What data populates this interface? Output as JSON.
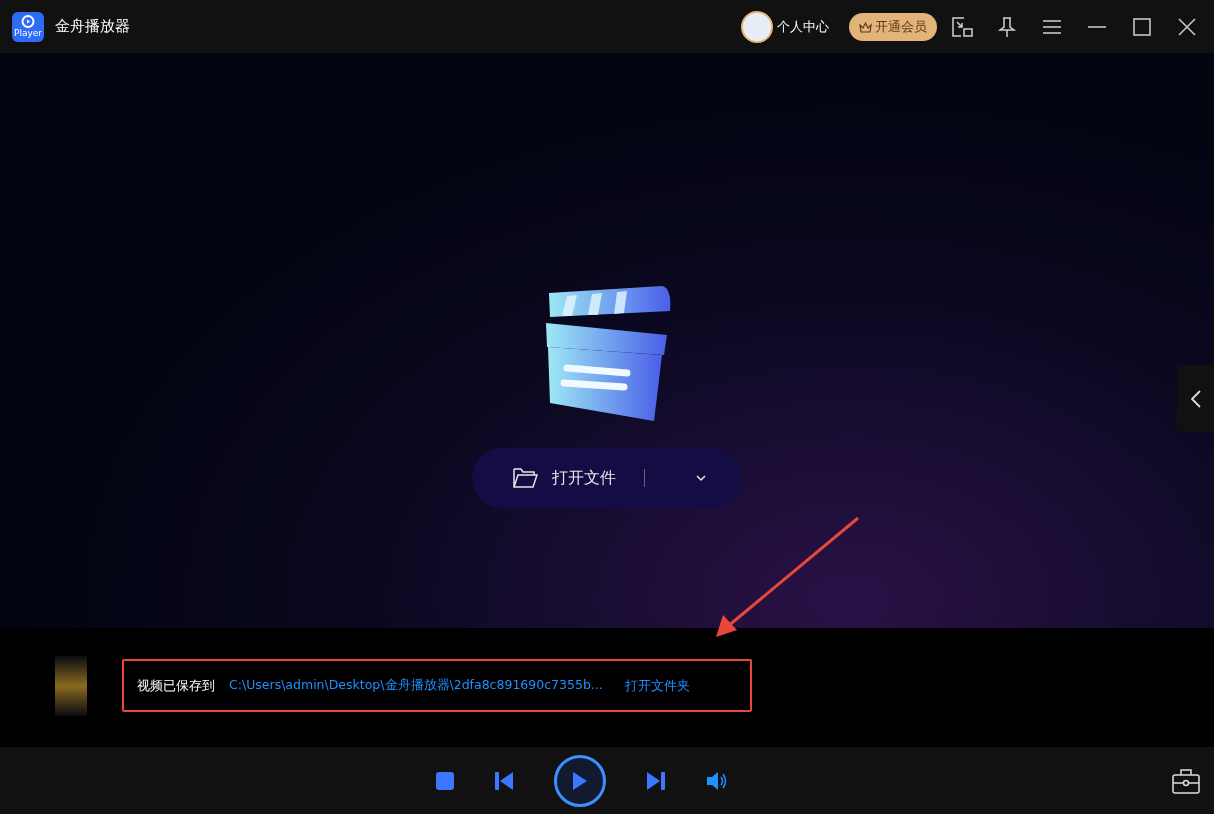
{
  "window": {
    "title": "金舟播放器",
    "logo_text": "Player"
  },
  "header": {
    "user_label": "个人中心",
    "vip_button": "开通会员"
  },
  "open_button": {
    "label": "打开文件"
  },
  "notice": {
    "label": "视频已保存到",
    "path": "C:\\Users\\admin\\Desktop\\金舟播放器\\2dfa8c891690c7355b...",
    "link": "打开文件夹"
  },
  "controls": {
    "playing": false
  }
}
